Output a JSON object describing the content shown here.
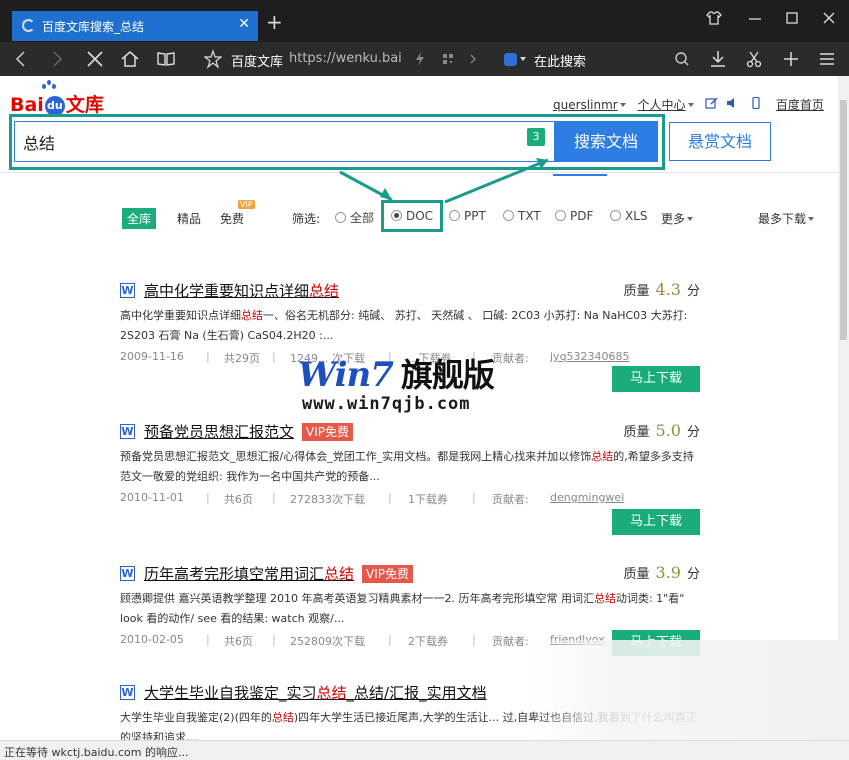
{
  "browser": {
    "tab_title": "百度文库搜索_总结",
    "tab_close": "✕",
    "new_tab": "+",
    "site_name": "百度文库",
    "url": "https://wenku.bai",
    "search_here": "在此搜索",
    "status": "正在等待 wkctj.baidu.com 的响应..."
  },
  "header": {
    "logo_bai": "Bai",
    "logo_du": "du",
    "logo_wenku": "文库",
    "username": "querslinmr",
    "personal_center": "个人中心",
    "home": "百度首页"
  },
  "search": {
    "query": "总结",
    "count_badge": "3",
    "search_button": "搜索文档",
    "reward_button": "悬赏文档"
  },
  "filters": {
    "tab_all": "全库",
    "tab_premium": "精品",
    "tab_free": "免费",
    "vip_tag": "VIP",
    "filter_label": "筛选:",
    "options": [
      {
        "label": "全部",
        "selected": false
      },
      {
        "label": "DOC",
        "selected": true
      },
      {
        "label": "PPT",
        "selected": false
      },
      {
        "label": "TXT",
        "selected": false
      },
      {
        "label": "PDF",
        "selected": false
      },
      {
        "label": "XLS",
        "selected": false
      }
    ],
    "more": "更多",
    "sort": "最多下载"
  },
  "results": [
    {
      "title_pre": "高中化学重要知识点详细",
      "title_hl": "总结",
      "title_post": "",
      "vip": "",
      "quality_label": "质量",
      "score": "4.3",
      "unit": "分",
      "snippet_pre": "高中化学重要知识点详细",
      "snippet_hl": "总结",
      "snippet_post": "一、俗名无机部分: 纯碱、 苏打、 天然碱 、 口碱: 2C03 小苏打: Na NaHC03 大苏打: 2S203 石膏 Na (生石膏) CaS04.2H20 :...",
      "date": "2009-11-16",
      "pages": "共29页",
      "downloads": "1249... 次下载",
      "coupon": "...下载券",
      "contributor_label": "贡献者:",
      "contributor": "jyq532340685",
      "download_button": "马上下载"
    },
    {
      "title_pre": "预备党员思想汇报范文",
      "title_hl": "",
      "title_post": "",
      "vip": "VIP免费",
      "quality_label": "质量",
      "score": "5.0",
      "unit": "分",
      "snippet_pre": "预备党员思想汇报范文_思想汇报/心得体会_党团工作_实用文档。都是我网上精心找来并加以修饰",
      "snippet_hl": "总结",
      "snippet_post": "的,希望多多支持 范文一敬爱的党组织: 我作为一名中国共产党的预备...",
      "date": "2010-11-01",
      "pages": "共6页",
      "downloads": "272833次下载",
      "coupon": "1下载券",
      "contributor_label": "贡献者:",
      "contributor": "dengmingwei",
      "download_button": "马上下载"
    },
    {
      "title_pre": "历年高考完形填空常用词汇",
      "title_hl": "总结",
      "title_post": "",
      "vip": "VIP免费",
      "quality_label": "质量",
      "score": "3.9",
      "unit": "分",
      "snippet_pre": "顾懑卿提供 嘉兴英语教学整理 2010 年高考英语复习精典素材一一2. 历年高考完形填空常 用词汇",
      "snippet_hl": "总结",
      "snippet_post": "动词类: 1\"看\" look 看的动作/ see 看的结果: watch 观察/...",
      "date": "2010-02-05",
      "pages": "共6页",
      "downloads": "252809次下载",
      "coupon": "2下载券",
      "contributor_label": "贡献者:",
      "contributor": "friendlyox",
      "download_button": "马上下载"
    },
    {
      "title_pre": "大学生毕业自我鉴定_实习",
      "title_hl": "总结",
      "title_post": "_总结/汇报_实用文档",
      "vip": "",
      "quality_label": "",
      "score": "",
      "unit": "",
      "snippet_pre": "大学生毕业自我鉴定(2)(四年的",
      "snippet_hl": "总结",
      "snippet_post": ")四年大学生活已接近尾声,大学的生活让... 过,自卑过也自信过,我看到了什么叫真正的坚持和追求,...",
      "date": "",
      "pages": "",
      "downloads": "",
      "coupon": "",
      "contributor_label": "",
      "contributor": "",
      "download_button": ""
    }
  ],
  "watermark": {
    "line1": "Win7",
    "line1_cn": "旗舰版",
    "line2": "www.win7qjb.com"
  },
  "colors": {
    "accent_blue": "#2d7de3",
    "green": "#1aad7a",
    "annotation_teal": "#1a9b8c",
    "highlight_red": "#cc0000"
  }
}
